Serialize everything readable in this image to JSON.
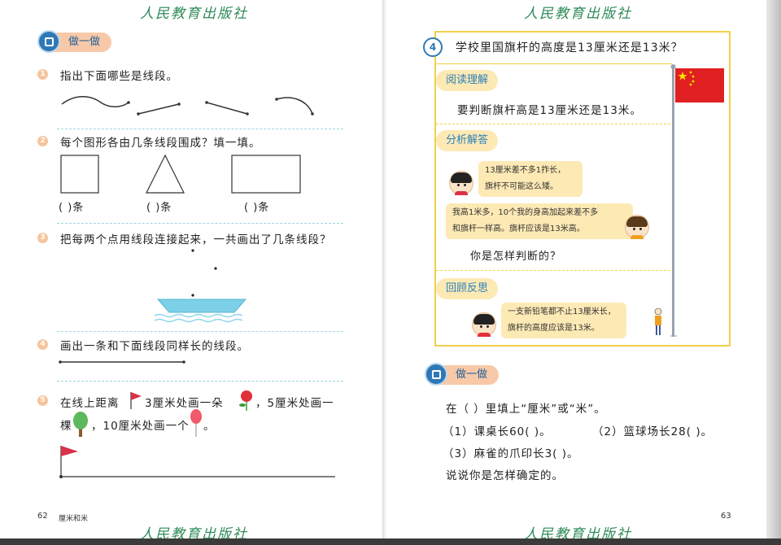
{
  "publisher": "人民教育出版社",
  "left": {
    "section_label": "做一做",
    "q1": {
      "num": "1",
      "text": "指出下面哪些是线段。"
    },
    "q2": {
      "num": "2",
      "text": "每个图形各由几条线段围成？填一填。",
      "blanks": [
        "(    )条",
        "(    )条",
        "(    )条"
      ]
    },
    "q3": {
      "num": "3",
      "text": "把每两个点用线段连接起来，一共画出了几条线段？"
    },
    "q4": {
      "num": "4",
      "text": "画出一条和下面线段同样长的线段。"
    },
    "q5": {
      "num": "5",
      "parts": [
        "在线上距离",
        "3厘米处画一朵",
        "，5厘米处画一",
        "棵",
        "，10厘米处画一个",
        "。"
      ]
    },
    "page_number": "62",
    "chapter": "厘米和米"
  },
  "right": {
    "problem": {
      "num": "4",
      "text": "学校里国旗杆的高度是13厘米还是13米？"
    },
    "read": {
      "label": "阅读理解",
      "text": "要判断旗杆高是13厘米还是13米。"
    },
    "analyze": {
      "label": "分析解答",
      "bubble1": [
        "13厘米差不多1拃长，",
        "旗杆不可能这么矮。"
      ],
      "bubble2": [
        "我高1米多，10个我的身高加起来差不多",
        "和旗杆一样高。旗杆应该是13米高。"
      ],
      "question": "你是怎样判断的？"
    },
    "review": {
      "label": "回顾反思",
      "bubble": [
        "一支新铅笔都不止13厘米长，",
        "旗杆的高度应该是13米。"
      ]
    },
    "section_label": "做一做",
    "fill": {
      "intro": "在（    ）里填上“厘米”或“米”。",
      "item1": "（1）课桌长60(        )。",
      "item2": "（2）篮球场长28(        )。",
      "item3": "（3）麻雀的爪印长3(        )。",
      "item4": "说说你是怎样确定的。"
    },
    "page_number": "63"
  },
  "colors": {
    "accent_green": "#2e8b57",
    "pill_bg": "#f8c9a8",
    "blue": "#2f78b8",
    "yellow_frame": "#f2cf4a",
    "flag_red": "#e02020"
  }
}
